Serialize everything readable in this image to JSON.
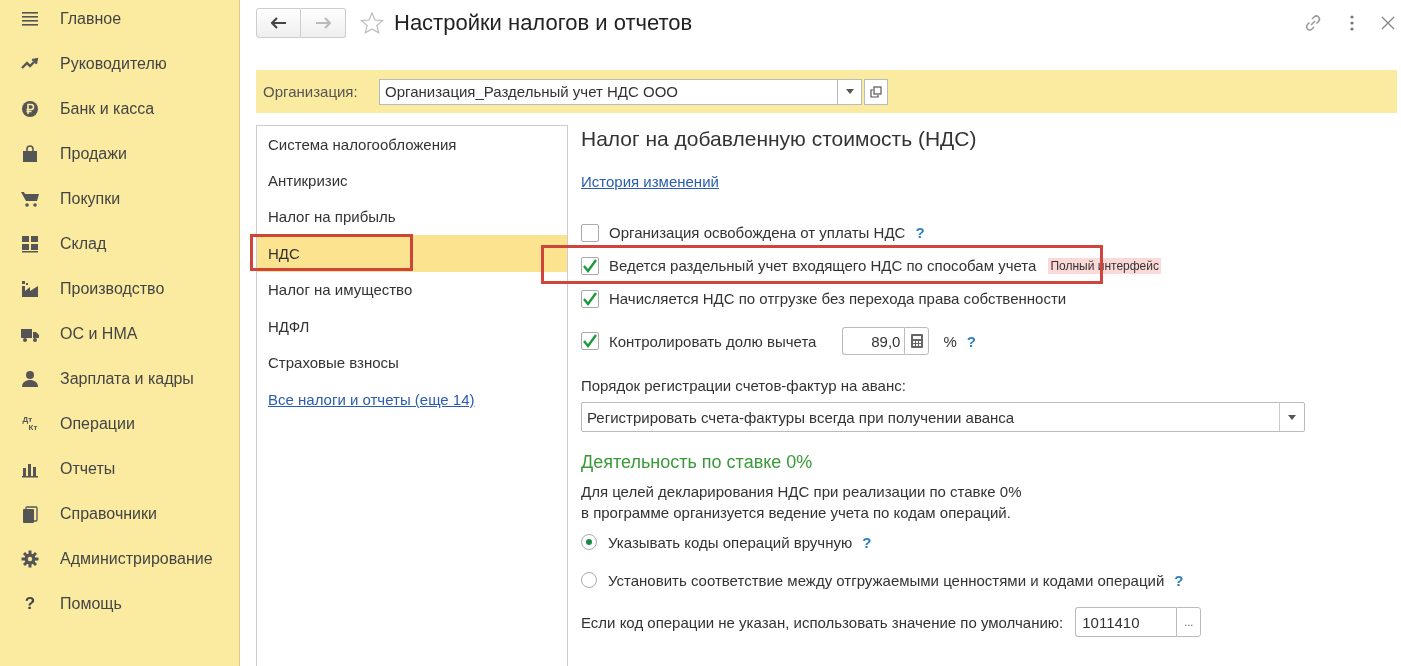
{
  "sidebar": {
    "items": [
      {
        "label": "Главное"
      },
      {
        "label": "Руководителю"
      },
      {
        "label": "Банк и касса"
      },
      {
        "label": "Продажи"
      },
      {
        "label": "Покупки"
      },
      {
        "label": "Склад"
      },
      {
        "label": "Производство"
      },
      {
        "label": "ОС и НМА"
      },
      {
        "label": "Зарплата и кадры"
      },
      {
        "label": "Операции",
        "icon_text": [
          "Дт",
          "Кт"
        ]
      },
      {
        "label": "Отчеты"
      },
      {
        "label": "Справочники"
      },
      {
        "label": "Администрирование"
      },
      {
        "label": "Помощь",
        "icon_text": [
          "?"
        ]
      }
    ]
  },
  "window": {
    "title": "Настройки налогов и отчетов"
  },
  "organization": {
    "label": "Организация:",
    "value": "Организация_Раздельный учет НДС ООО"
  },
  "sections": {
    "items": [
      {
        "label": "Система налогообложения",
        "selected": false,
        "highlighted": false
      },
      {
        "label": "Антикризис",
        "selected": false,
        "highlighted": false
      },
      {
        "label": "Налог на прибыль",
        "selected": false,
        "highlighted": false
      },
      {
        "label": "НДС",
        "selected": true,
        "highlighted": true
      },
      {
        "label": "Налог на имущество",
        "selected": false,
        "highlighted": false
      },
      {
        "label": "НДФЛ",
        "selected": false,
        "highlighted": false
      },
      {
        "label": "Страховые взносы",
        "selected": false,
        "highlighted": false
      }
    ],
    "more_link": "Все налоги и отчеты (еще 14)"
  },
  "vat": {
    "title": "Налог на добавленную стоимость (НДС)",
    "history_link": "История изменений",
    "options": [
      {
        "label": "Организация освобождена от уплаты НДС",
        "checked": false,
        "highlighted": false,
        "help": "?"
      },
      {
        "label": "Ведется раздельный учет входящего НДС по способам учета",
        "checked": true,
        "highlighted": true,
        "badge": "Полный интерфейс"
      },
      {
        "label": "Начисляется НДС по отгрузке без перехода права собственности",
        "checked": true,
        "highlighted": false
      },
      {
        "label": "Контролировать долю вычета",
        "checked": true,
        "highlighted": false,
        "value": "89,0",
        "unit": "%",
        "help": "?"
      }
    ],
    "invoice_label": "Порядок регистрации счетов-фактур на аванс:",
    "invoice_value": "Регистрировать счета-фактуры всегда при получении аванса",
    "zero_rate": {
      "title": "Деятельность по ставке 0%",
      "description": [
        "Для целей декларирования НДС при реализации по ставке 0%",
        "в программе организуется ведение учета по кодам операций."
      ],
      "modes": [
        {
          "label": "Указывать коды операций вручную",
          "selected": true,
          "help": "?"
        },
        {
          "label": "Установить соответствие между отгружаемыми ценностями и кодами операций",
          "selected": false,
          "help": "?"
        }
      ],
      "default_label": "Если код операции не указан, использовать значение по умолчанию:",
      "default_value": "1011410",
      "pick_button": "..."
    }
  }
}
